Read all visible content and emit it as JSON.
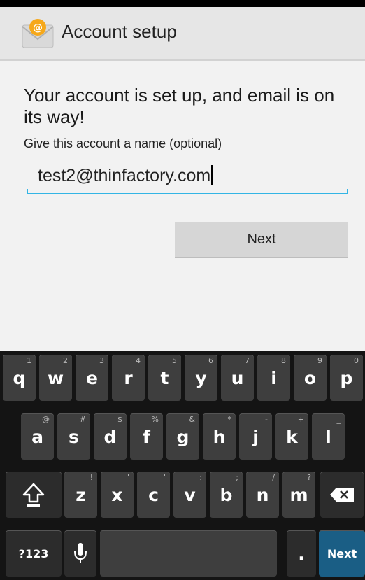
{
  "header": {
    "title": "Account setup",
    "icon": "email-app-icon"
  },
  "form": {
    "heading": "Your account is set up, and email is on its way!",
    "name_label": "Give this account a name (optional)",
    "name_value": "test2@thinfactory.com",
    "next_label": "Next"
  },
  "keyboard": {
    "row1": [
      {
        "key": "q",
        "hint": "1"
      },
      {
        "key": "w",
        "hint": "2"
      },
      {
        "key": "e",
        "hint": "3"
      },
      {
        "key": "r",
        "hint": "4"
      },
      {
        "key": "t",
        "hint": "5"
      },
      {
        "key": "y",
        "hint": "6"
      },
      {
        "key": "u",
        "hint": "7"
      },
      {
        "key": "i",
        "hint": "8"
      },
      {
        "key": "o",
        "hint": "9"
      },
      {
        "key": "p",
        "hint": "0"
      }
    ],
    "row2": [
      {
        "key": "a",
        "hint": "@"
      },
      {
        "key": "s",
        "hint": "#"
      },
      {
        "key": "d",
        "hint": "$"
      },
      {
        "key": "f",
        "hint": "%"
      },
      {
        "key": "g",
        "hint": "&"
      },
      {
        "key": "h",
        "hint": "*"
      },
      {
        "key": "j",
        "hint": "-"
      },
      {
        "key": "k",
        "hint": "+"
      },
      {
        "key": "l",
        "hint": "_"
      }
    ],
    "row3": [
      {
        "key": "z",
        "hint": "!"
      },
      {
        "key": "x",
        "hint": "\""
      },
      {
        "key": "c",
        "hint": "'"
      },
      {
        "key": "v",
        "hint": ":"
      },
      {
        "key": "b",
        "hint": ";"
      },
      {
        "key": "n",
        "hint": "/"
      },
      {
        "key": "m",
        "hint": "?"
      }
    ],
    "symbols_label": "?123",
    "period_label": ".",
    "next_label": "Next"
  }
}
